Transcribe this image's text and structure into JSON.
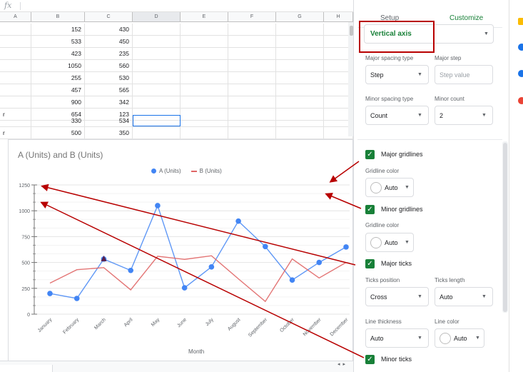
{
  "formula_bar": {
    "fx_label": "fx"
  },
  "sheet": {
    "columns": [
      "A",
      "B",
      "C",
      "D",
      "E",
      "F",
      "G",
      "H"
    ],
    "rows": [
      {
        "a": "",
        "b": "152",
        "c": "430"
      },
      {
        "a": "",
        "b": "533",
        "c": "450"
      },
      {
        "a": "",
        "b": "423",
        "c": "235"
      },
      {
        "a": "",
        "b": "1050",
        "c": "560"
      },
      {
        "a": "",
        "b": "255",
        "c": "530"
      },
      {
        "a": "",
        "b": "457",
        "c": "565"
      },
      {
        "a": "",
        "b": "900",
        "c": "342"
      },
      {
        "a": "r",
        "b": "654",
        "c": "123"
      },
      {
        "a": "",
        "b": "330",
        "c": "534"
      },
      {
        "a": "r",
        "b": "500",
        "c": "350"
      }
    ]
  },
  "chart": {
    "title": "A (Units) and B (Units)",
    "legend": [
      "A (Units)",
      "B (Units)"
    ],
    "xlabel": "Month"
  },
  "chart_data": {
    "type": "line",
    "title": "A (Units) and B (Units)",
    "xlabel": "Month",
    "ylabel": "",
    "categories": [
      "January",
      "February",
      "March",
      "April",
      "May",
      "June",
      "July",
      "August",
      "September",
      "October",
      "November",
      "December"
    ],
    "yticks": [
      "0",
      "250",
      "500",
      "750",
      "1000",
      "1250"
    ],
    "ylim": [
      0,
      1250
    ],
    "series": [
      {
        "name": "A (Units)",
        "color": "#4285f4",
        "markers": true,
        "values": [
          200,
          152,
          533,
          423,
          1050,
          255,
          457,
          900,
          654,
          330,
          500,
          650
        ]
      },
      {
        "name": "B (Units)",
        "color": "#e06666",
        "markers": false,
        "values": [
          300,
          430,
          450,
          235,
          560,
          530,
          565,
          342,
          123,
          534,
          350,
          500
        ]
      }
    ],
    "legend_position": "top",
    "grid": true
  },
  "panel": {
    "tabs": {
      "setup": "Setup",
      "customize": "Customize"
    },
    "section": "Vertical axis",
    "major_spacing_type": {
      "label": "Major spacing type",
      "value": "Step"
    },
    "major_step": {
      "label": "Major step",
      "placeholder": "Step value"
    },
    "minor_spacing_type": {
      "label": "Minor spacing type",
      "value": "Count"
    },
    "minor_count": {
      "label": "Minor count",
      "value": "2"
    },
    "major_gridlines": {
      "label": "Major gridlines",
      "checked": true
    },
    "major_gridline_color": {
      "label": "Gridline color",
      "value": "Auto"
    },
    "minor_gridlines": {
      "label": "Minor gridlines",
      "checked": true
    },
    "minor_gridline_color": {
      "label": "Gridline color",
      "value": "Auto"
    },
    "major_ticks": {
      "label": "Major ticks",
      "checked": true
    },
    "ticks_position": {
      "label": "Ticks position",
      "value": "Cross"
    },
    "ticks_length": {
      "label": "Ticks length",
      "value": "Auto"
    },
    "line_thickness": {
      "label": "Line thickness",
      "value": "Auto"
    },
    "line_color": {
      "label": "Line color",
      "value": "Auto"
    },
    "minor_ticks": {
      "label": "Minor ticks",
      "checked": true
    }
  },
  "colors": {
    "accent": "#188038",
    "annotation": "#b80000",
    "series_a": "#4285f4",
    "series_b": "#e06666"
  }
}
